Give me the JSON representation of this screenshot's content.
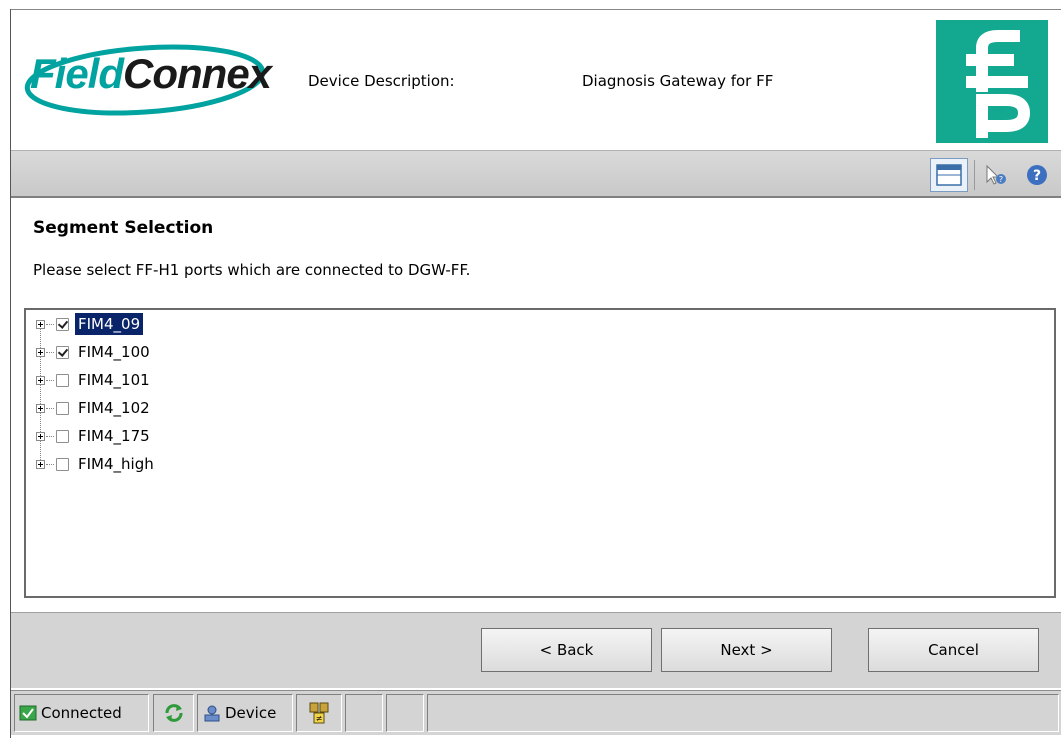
{
  "header": {
    "logo_part1": "Field",
    "logo_part2": "Connex",
    "device_description_label": "Device Description:",
    "device_description_value": "Diagnosis Gateway for FF",
    "brand_color": "#13a890"
  },
  "toolbar": {
    "icons": [
      "window-icon",
      "context-help-pointer-icon",
      "help-icon"
    ]
  },
  "page": {
    "title": "Segment Selection",
    "subtitle": "Please select FF-H1 ports which are connected to DGW-FF."
  },
  "tree": {
    "items": [
      {
        "label": "FIM4_09",
        "checked": true,
        "selected": true
      },
      {
        "label": "FIM4_100",
        "checked": true,
        "selected": false
      },
      {
        "label": "FIM4_101",
        "checked": false,
        "selected": false
      },
      {
        "label": "FIM4_102",
        "checked": false,
        "selected": false
      },
      {
        "label": "FIM4_175",
        "checked": false,
        "selected": false
      },
      {
        "label": "FIM4_high",
        "checked": false,
        "selected": false
      }
    ]
  },
  "buttons": {
    "back": "< Back",
    "next": "Next >",
    "cancel": "Cancel"
  },
  "status": {
    "connected": "Connected",
    "device": "Device"
  }
}
